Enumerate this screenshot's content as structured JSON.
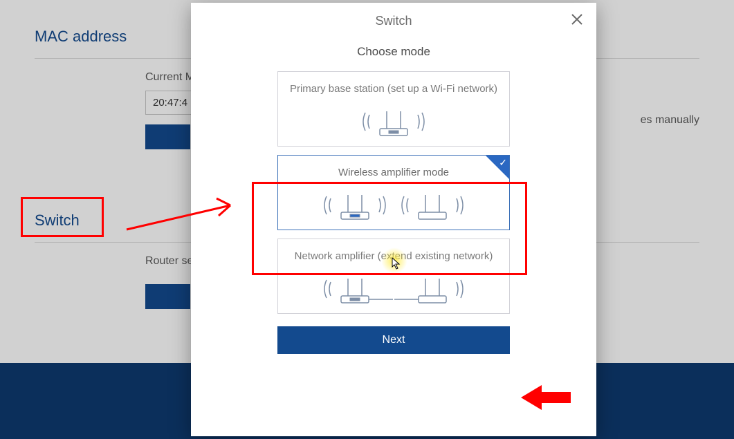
{
  "page": {
    "mac_title": "MAC address",
    "current_label": "Current M",
    "mac_value": "20:47:4",
    "manual_text": "es manually",
    "switch_title": "Switch",
    "router_label": "Router se"
  },
  "modal": {
    "title": "Switch",
    "subtitle": "Choose mode",
    "options": [
      {
        "label": "Primary base station (set up a Wi-Fi network)"
      },
      {
        "label": "Wireless amplifier mode"
      },
      {
        "label": "Network amplifier (extend existing network)"
      }
    ],
    "next_label": "Next"
  }
}
